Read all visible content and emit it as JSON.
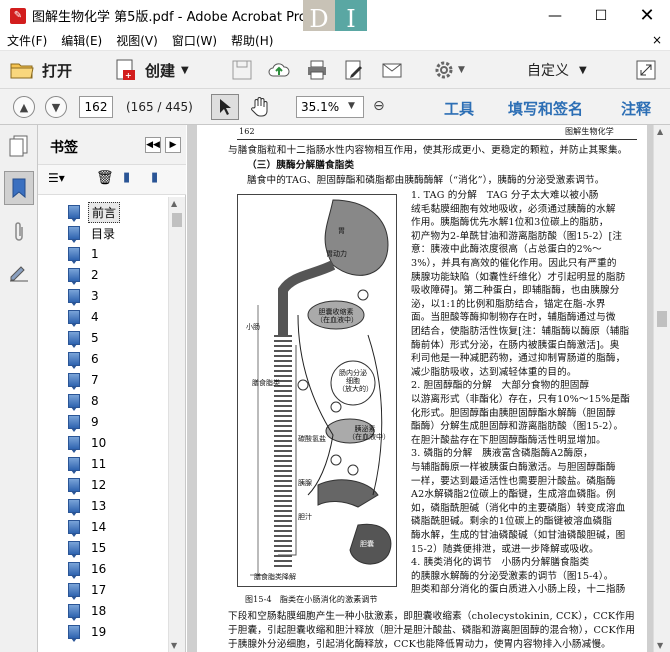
{
  "window": {
    "title": "图解生物化学 第5版.pdf - Adobe Acrobat Pro",
    "app_icon": "acrobat-pdf-icon",
    "ime_left": "D",
    "ime_right": "I"
  },
  "menu": {
    "items": [
      "文件(F)",
      "编辑(E)",
      "视图(V)",
      "窗口(W)",
      "帮助(H)"
    ],
    "close": "×"
  },
  "toolbar": {
    "open_label": "打开",
    "create_label": "创建",
    "customize_label": "自定义"
  },
  "nav": {
    "page": "162",
    "page_count": "(165 / 445)",
    "zoom": "35.1%",
    "tools": "工具",
    "fill_sign": "填写和签名",
    "comment": "注释"
  },
  "bookmarks": {
    "title": "书签",
    "items": [
      "前言",
      "目录",
      "1",
      "2",
      "3",
      "4",
      "5",
      "6",
      "7",
      "8",
      "9",
      "10",
      "11",
      "12",
      "13",
      "14",
      "15",
      "16",
      "17",
      "18",
      "19"
    ]
  },
  "document": {
    "page_number": "162",
    "running_head": "图解生物化学",
    "lines_top": [
      "与膳食脂粒和十二指肠水性内容物相互作用，使其形成更小、更稳定的颗粒，并防止其聚集。",
      "（三）胰酶分解膳食脂类",
      "膳食中的TAG、胆固醇酯和磷脂都由胰酶酶解（“消化”），胰酶的分泌受激素调节。"
    ],
    "right_paragraphs": [
      "1. TAG 的分解　TAG 分子太大难以被小肠",
      "绒毛黏膜细胞有效地吸收，必须通过胰酶的水解",
      "作用。胰脂酶优先水解1位和3位碳上的脂肪，",
      "初产物为2-单酰甘油和游离脂肪酸（图15-2）[注",
      "意：胰液中此酶浓度很高（占总蛋白的2%～",
      "3%），并具有高效的催化作用。因此只有严重的",
      "胰腺功能缺陷（如囊性纤维化）才引起明显的脂肪",
      "吸收障碍]。第二种蛋白，即辅脂酶，也由胰腺分",
      "泌，以1:1的比例和脂肪结合，锚定在脂-水界",
      "面。当胆酸等酶抑制物存在时，辅脂酶通过与微",
      "团结合，使脂肪活性恢复[注：辅脂酶以酶原（辅脂",
      "酶前体）形式分泌，在肠内被胰蛋白酶激活]。奥",
      "利司他是一种减肥药物，通过抑制胃肠道的脂酶，",
      "减少脂肪吸收，达到减轻体重的目的。",
      "2. 胆固醇酯的分解　大部分食物的胆固醇",
      "以游离形式（非酯化）存在，只有10%～15%是酯",
      "化形式。胆固醇酯由胰胆固醇酯水解酶（胆固醇",
      "酯酶）分解生成胆固醇和游离脂肪酸（图15-2）。",
      "在胆汁酸盐存在下胆固醇酯酶活性明显增加。",
      "3. 磷脂的分解　胰液富含磷脂酶A2酶原，",
      "与辅脂酶原一样被胰蛋白酶激活。与胆固醇酯酶",
      "一样，要达到最适活性也需要胆汁酸盐。磷脂酶",
      "A2水解磷脂2位碳上的酯键，生成溶血磷脂。例",
      "如，磷脂酰胆碱（消化中的主要磷脂）转变成溶血",
      "磷脂酰胆碱。剩余的1位碳上的酯键被溶血磷脂",
      "酶水解，生成的甘油磷酸碱（如甘油磷酸胆碱，图",
      "15-2）随粪便排泄，或进一步降解或吸收。",
      "4. 胰类消化的调节　小肠内分解膳食脂类",
      "的胰腺水解酶的分泌受激素的调节（图15-4）。",
      "胆类和部分消化的蛋白质进入小肠上段，十二指肠"
    ],
    "bottom_lines": [
      "下段和空肠黏膜细胞产生一种小肽激素，即胆囊收缩素（cholecystokinin, CCK），CCK作用",
      "于胆囊，引起胆囊收缩和胆汁释放（胆汁是胆汁酸盐、磷脂和游离胆固醇的混合物），CCK作用",
      "于胰腺外分泌细胞，引起消化酶释放，CCK也能降低胃动力，使胃内容物排入小肠减慢。"
    ],
    "figure_caption": "图15-4　脂类在小肠消化的激素调节",
    "figure_labels": {
      "stomach": "胃",
      "gastric_motility": "胃动力",
      "small_intestine": "小肠",
      "cck": "胆囊收缩素\n（在血液中）",
      "intestinal_cells": "肠内分泌\n细胞\n（放大的）",
      "dietary_fat": "膳食脂类",
      "bile_salts": "膳酸盐类",
      "secretin": "胰泌素\n（在血液中）",
      "pancreas": "胰腺",
      "bicarbonate": "碳酸氢盐",
      "bile_acid": "胆汁",
      "gallbladder": "胆囊",
      "digestion": "膳食脂类降解"
    }
  }
}
